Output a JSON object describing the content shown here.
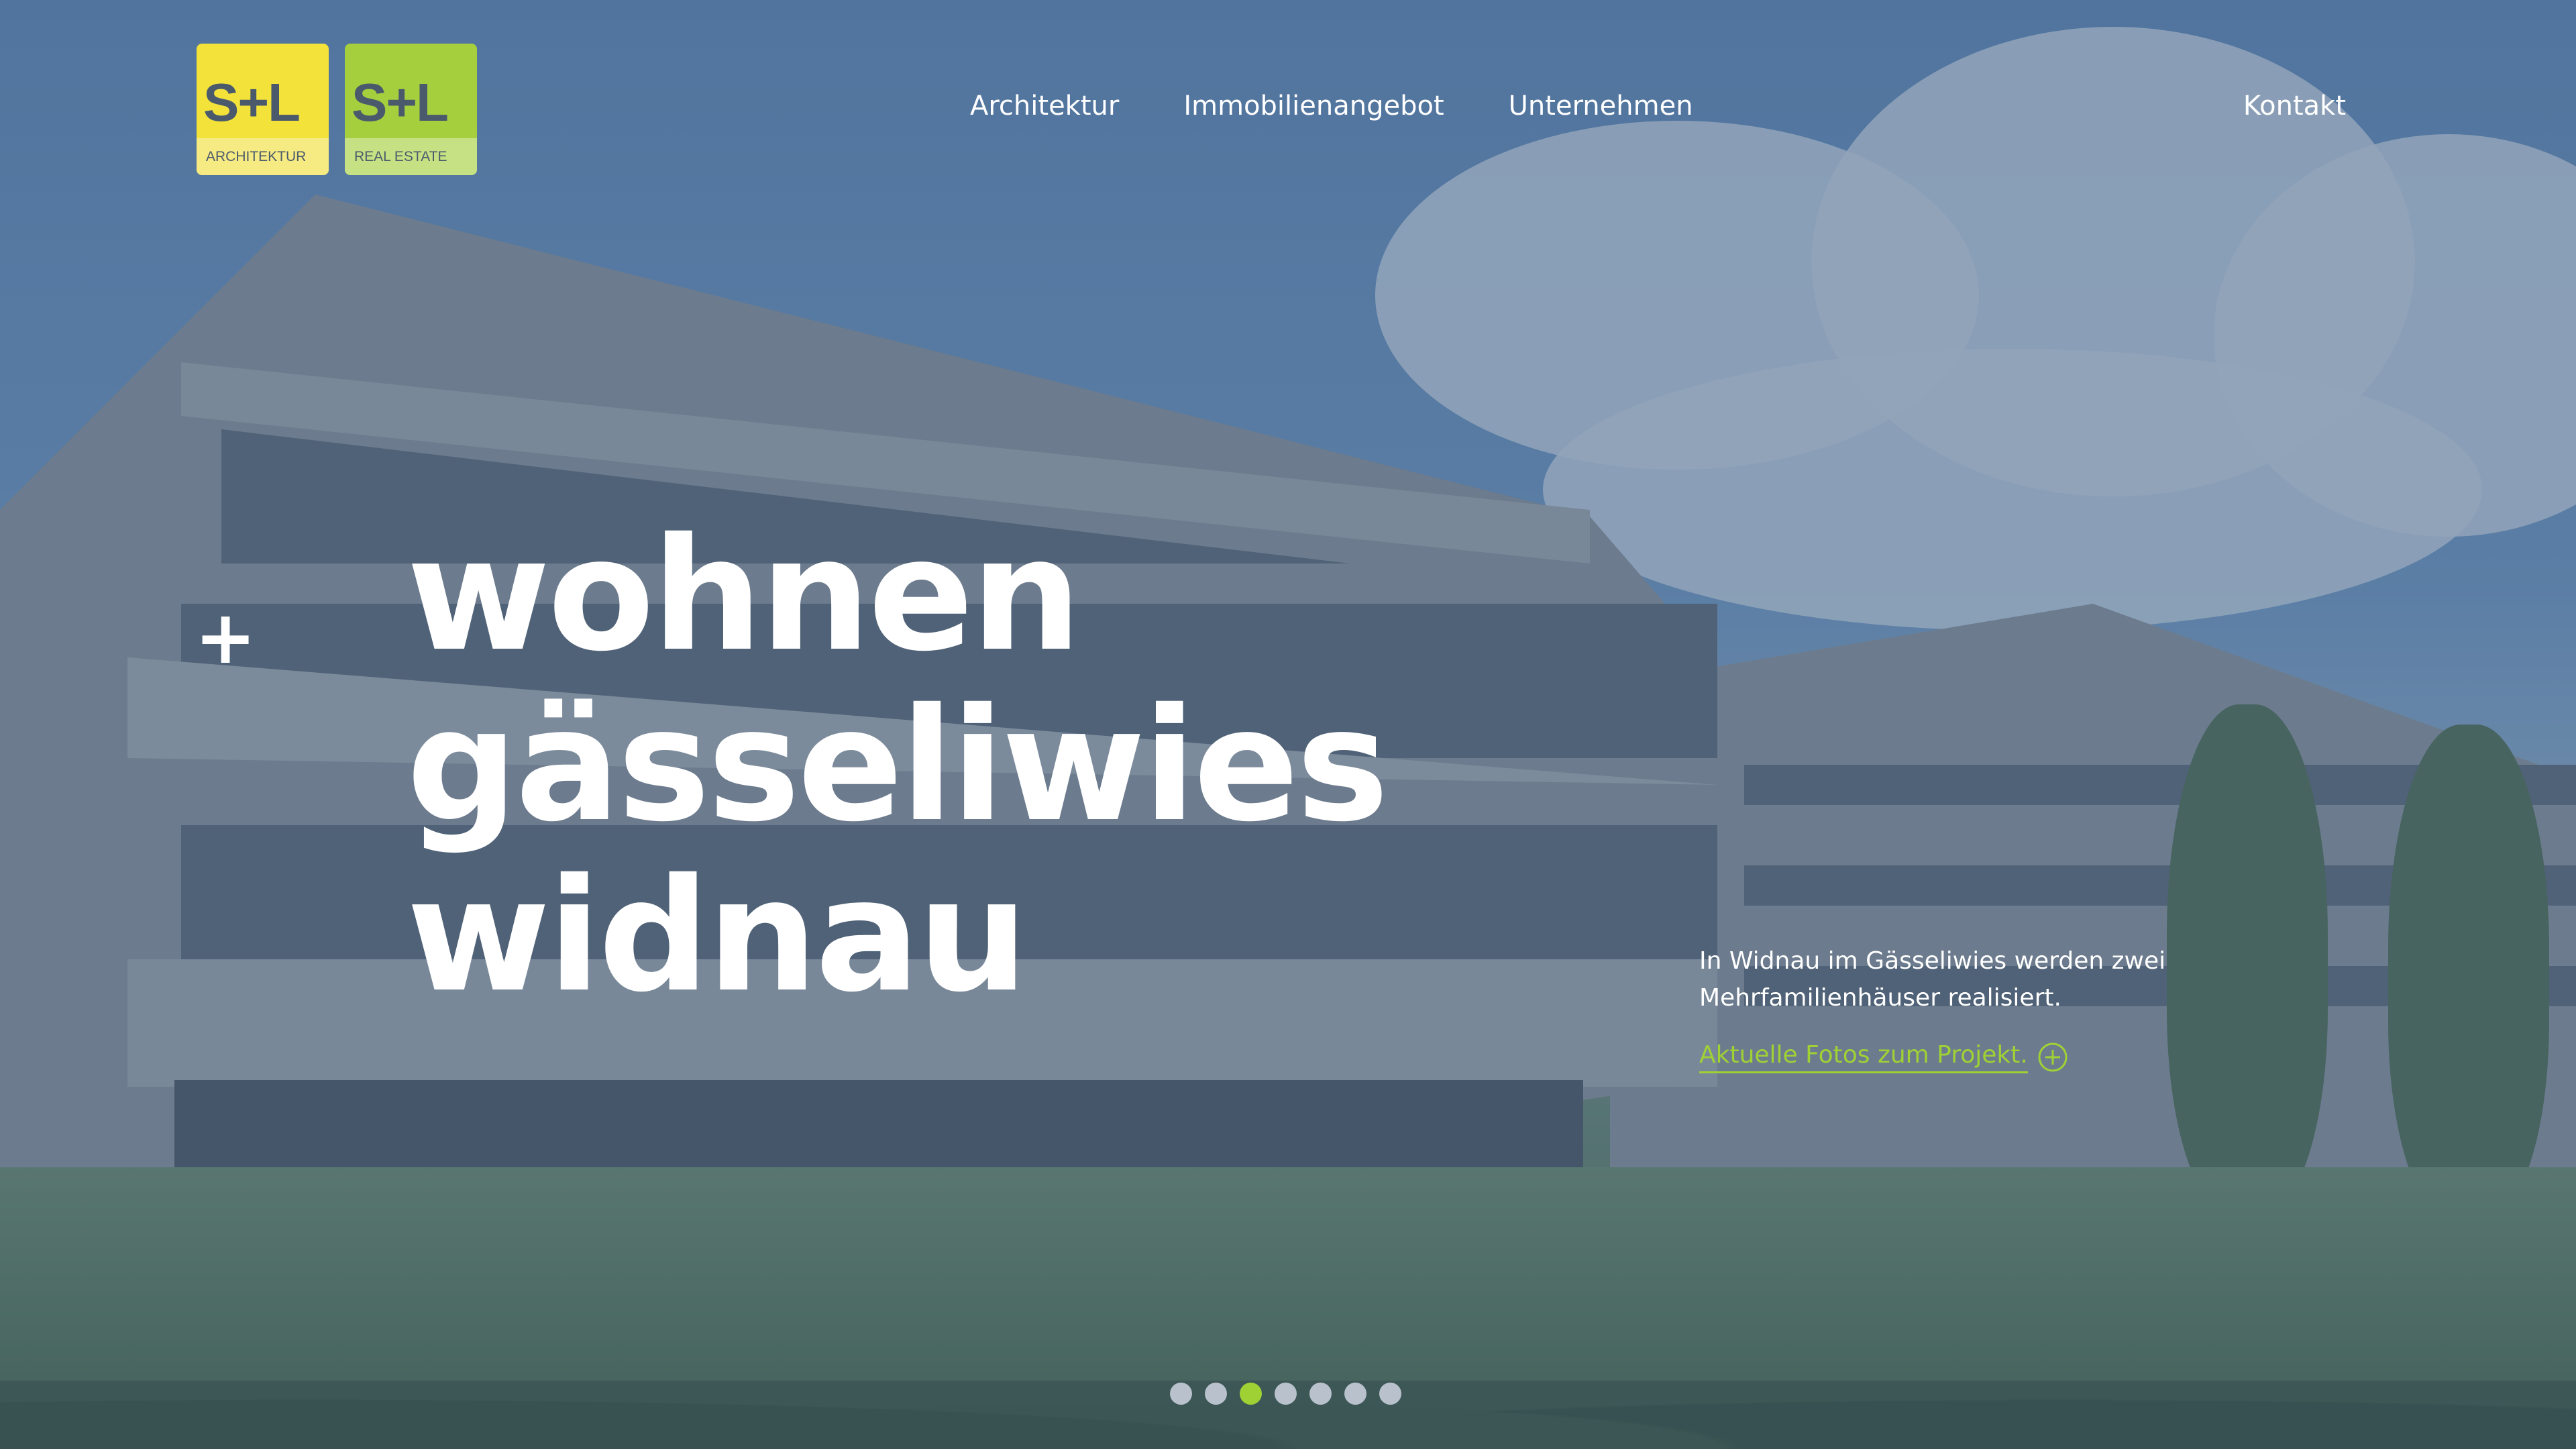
{
  "brand": {
    "logos": [
      {
        "mark": "S+L",
        "subtitle": "ARCHITEKTUR",
        "color": "#f3e23a"
      },
      {
        "mark": "S+L",
        "subtitle": "REAL ESTATE",
        "color": "#a6cf3e"
      }
    ]
  },
  "nav": {
    "items": [
      "Architektur",
      "Immobilienangebot",
      "Unternehmen"
    ],
    "contact": "Kontakt"
  },
  "hero": {
    "plus_glyph": "+",
    "headline_lines": [
      "wohnen",
      "gässeliwies",
      "widnau"
    ],
    "intro": "In Widnau im Gässeliwies werden zwei Mehrfamilienhäuser realisiert.",
    "link_label": "Aktuelle Fotos zum Projekt.",
    "link_icon": "plus-circle-icon",
    "accent_color": "#9fd135"
  },
  "slider": {
    "count": 7,
    "active_index": 2
  }
}
